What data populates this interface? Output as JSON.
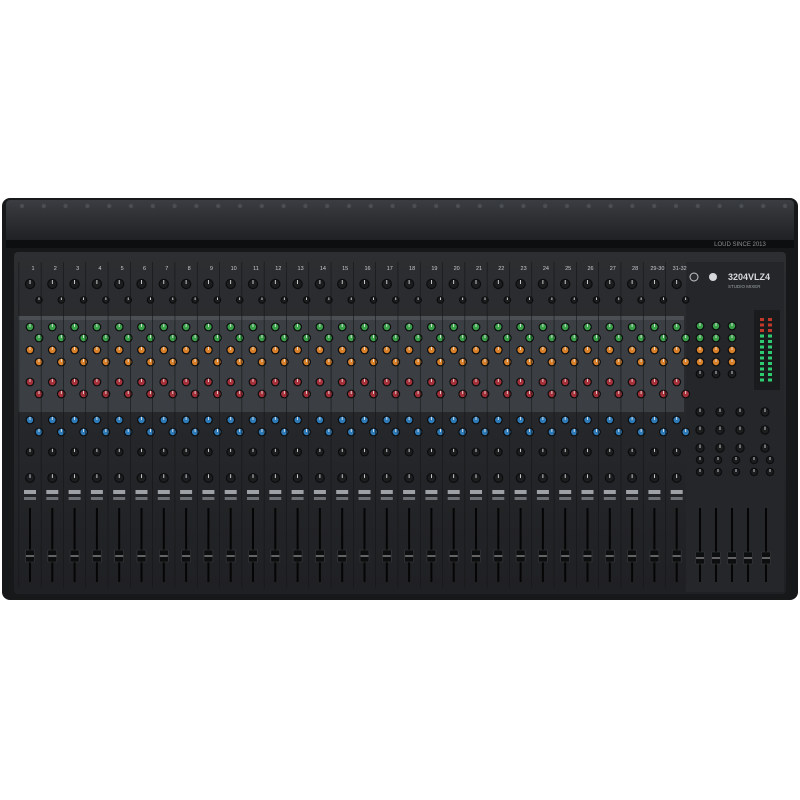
{
  "device": {
    "model": "3204VLZ4",
    "tagline": "STUDIO MIXER"
  },
  "top_bar_text": "LOUD SINCE 2013",
  "mono_channels": [
    "1",
    "2",
    "3",
    "4",
    "5",
    "6",
    "7",
    "8",
    "9",
    "10",
    "11",
    "12",
    "13",
    "14",
    "15",
    "16",
    "17",
    "18",
    "19",
    "20",
    "21",
    "22",
    "23",
    "24",
    "25",
    "26",
    "27",
    "28"
  ],
  "stereo_channels": [
    "29-30",
    "31-32"
  ],
  "knob_colors": {
    "gain": "#1c1d1f",
    "aux_green": "#3aa04a",
    "aux_orange": "#d8802a",
    "eq_red": "#a6303a",
    "eq_blue": "#2f7bb8",
    "pan": "#1c1d1f"
  },
  "icons": {
    "phantom_switch": "power-switch-icon",
    "logo": "running-man-logo-icon"
  }
}
